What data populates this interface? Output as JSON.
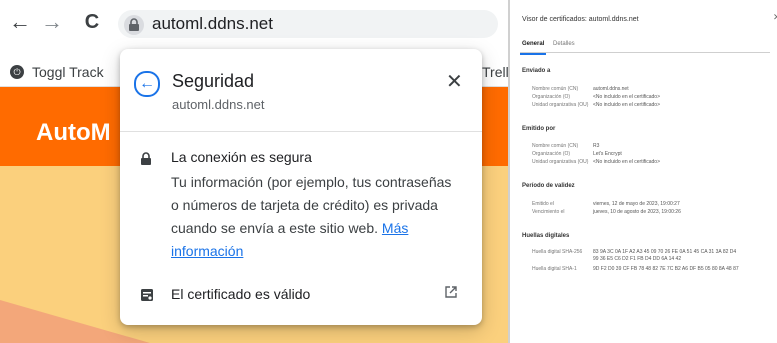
{
  "browser": {
    "url": "automl.ddns.net",
    "bookmarks": [
      "Toggl Track",
      "Trello"
    ],
    "page_brand": "AutoM"
  },
  "popup": {
    "title": "Seguridad",
    "domain": "automl.ddns.net",
    "connection_label": "La conexión es segura",
    "description": "Tu información (por ejemplo, tus contraseñas o números de tarjeta de crédito) es privada cuando se envía a este sitio web.",
    "more_info_link": "Más información",
    "certificate_label": "El certificado es válido"
  },
  "cert_viewer": {
    "title": "Visor de certificados: automl.ddns.net",
    "tabs": [
      "General",
      "Detalles"
    ],
    "issued_to_heading": "Enviado a",
    "issued_to": [
      {
        "label": "Nombre común (CN)",
        "value": "automl.ddns.net"
      },
      {
        "label": "Organización (O)",
        "value": "<No incluido en el certificado>"
      },
      {
        "label": "Unidad organizativa (OU)",
        "value": "<No incluido en el certificado>"
      }
    ],
    "issued_by_heading": "Emitido por",
    "issued_by": [
      {
        "label": "Nombre común (CN)",
        "value": "R3"
      },
      {
        "label": "Organización (O)",
        "value": "Let's Encrypt"
      },
      {
        "label": "Unidad organizativa (OU)",
        "value": "<No incluido en el certificado>"
      }
    ],
    "validity_heading": "Período de validez",
    "validity": [
      {
        "label": "Emitido el",
        "value": "viernes, 12 de mayo de 2023, 19:00:27"
      },
      {
        "label": "Vencimiento el",
        "value": "jueves, 10 de agosto de 2023, 19:00:26"
      }
    ],
    "fingerprints_heading": "Huellas digitales",
    "fingerprints": [
      {
        "label": "Huella digital SHA-256",
        "value": "83 9A 3C 0A 1F A2 A3 45 09 70 26 FE 0A 51 45 CA 31 3A 82 D4 99 36 E5 C6 D2 F1 FB D4 DD 6A 14 42"
      },
      {
        "label": "Huella digital SHA-1",
        "value": "9D F2 D0 39 CF FB 78 48 82 7E 7C B2 A6 DF B5 05 80 8A 48 87"
      }
    ]
  }
}
